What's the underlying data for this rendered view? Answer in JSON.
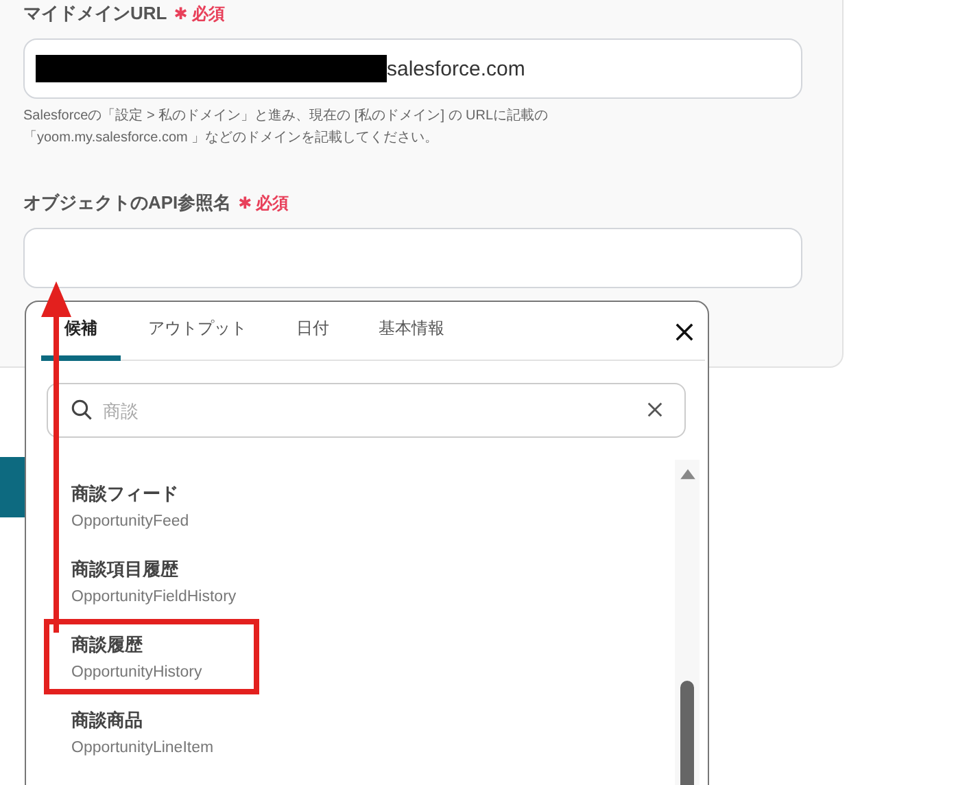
{
  "fields": [
    {
      "label": "マイドメインURL",
      "required_mark": "✱",
      "required": "必須",
      "value": "salesforce.com",
      "redacted": true,
      "help": "Salesforceの「設定 > 私のドメイン」と進み、現在の [私のドメイン] の URLに記載の「yoom.my.salesforce.com 」などのドメインを記載してください。"
    },
    {
      "label": "オブジェクトのAPI参照名",
      "required_mark": "✱",
      "required": "必須",
      "redacted": false
    }
  ],
  "popup": {
    "tabs": [
      {
        "label": "候補",
        "selected": true
      },
      {
        "label": "アウトプット",
        "selected": false
      },
      {
        "label": "日付",
        "selected": false
      },
      {
        "label": "基本情報",
        "selected": false
      }
    ],
    "search": {
      "placeholder": "商談"
    },
    "items": [
      {
        "name": "商談フィード",
        "api": "OpportunityFeed",
        "highlighted": false
      },
      {
        "name": "商談項目履歴",
        "api": "OpportunityFieldHistory",
        "highlighted": false
      },
      {
        "name": "商談履歴",
        "api": "OpportunityHistory",
        "highlighted": true
      },
      {
        "name": "商談商品",
        "api": "OpportunityLineItem",
        "highlighted": false
      }
    ]
  }
}
